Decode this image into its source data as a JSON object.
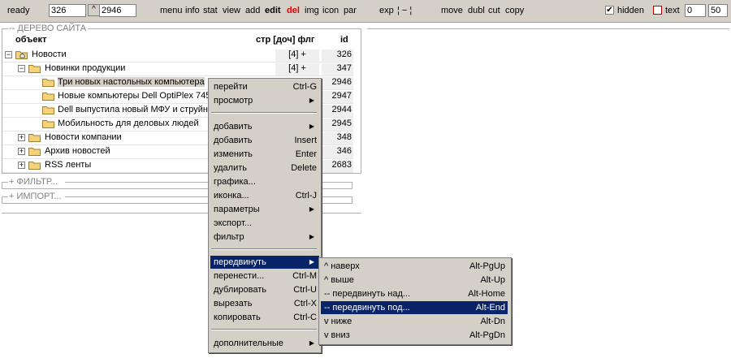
{
  "toolbar": {
    "status": "ready",
    "id_value": "326",
    "up_glyph": "^",
    "target_value": "2946",
    "menu_items": [
      "menu",
      "info",
      "stat",
      "view",
      "add"
    ],
    "edit": "edit",
    "del": "del",
    "menu_items2": [
      "img",
      "icon",
      "par"
    ],
    "exp": "exp",
    "exp_sep": "¦ − ¦",
    "actions": [
      "move",
      "dubl",
      "cut",
      "copy"
    ],
    "hidden_label": "hidden",
    "hidden_checked": true,
    "text_label": "text",
    "text_checked": false,
    "from_value": "0",
    "count_value": "50"
  },
  "tree_panel": {
    "title": "-- ДЕРЕВО САЙТА",
    "col_object": "объект",
    "col_meta": "стр [доч] флг",
    "col_id": "id"
  },
  "tree_rows": [
    {
      "expander": "−",
      "title": "Новости",
      "count": "[4] +",
      "id": "326",
      "icon": "folder-home-icon"
    },
    {
      "expander": "−",
      "title": "Новинки продукции",
      "count": "[4] +",
      "id": "347",
      "icon": "folder-icon"
    },
    {
      "expander": "",
      "title": "Три новых настольных компьютера",
      "count": "",
      "id": "2946",
      "icon": "folder-icon"
    },
    {
      "expander": "",
      "title": "Новые компьютеры Dell OptiPlex 745",
      "count": "",
      "id": "2947",
      "icon": "folder-icon"
    },
    {
      "expander": "",
      "title": "Dell выпустила новый МФУ и струйн",
      "count": "",
      "id": "2944",
      "icon": "folder-icon"
    },
    {
      "expander": "",
      "title": "Мобильность для деловых людей",
      "count": "",
      "id": "2945",
      "icon": "folder-icon"
    },
    {
      "expander": "+",
      "title": "Новости компании",
      "count": "",
      "id": "348",
      "icon": "folder-icon"
    },
    {
      "expander": "+",
      "title": "Архив новостей",
      "count": "",
      "id": "346",
      "icon": "folder-icon"
    },
    {
      "expander": "+",
      "title": "RSS ленты",
      "count": "",
      "id": "2683",
      "icon": "folder-icon"
    }
  ],
  "filter_panel": {
    "title": "+ ФИЛЬТР..."
  },
  "import_panel": {
    "title": "+ ИМПОРТ..."
  },
  "context_menu": {
    "items": [
      {
        "label": "перейти",
        "shortcut": "Ctrl-G"
      },
      {
        "label": "просмотр",
        "arrow": "▶"
      },
      {
        "label": "добавить",
        "arrow": "▶"
      },
      {
        "label": "добавить",
        "shortcut": "Insert"
      },
      {
        "label": "изменить",
        "shortcut": "Enter"
      },
      {
        "label": "удалить",
        "shortcut": "Delete"
      },
      {
        "label": "графика..."
      },
      {
        "label": "иконка...",
        "shortcut": "Ctrl-J"
      },
      {
        "label": "параметры",
        "arrow": "▶"
      },
      {
        "label": "экспорт..."
      },
      {
        "label": "фильтр",
        "arrow": "▶"
      },
      {
        "label": "передвинуть",
        "arrow": "▶"
      },
      {
        "label": "перенести...",
        "shortcut": "Ctrl-M"
      },
      {
        "label": "дублировать",
        "shortcut": "Ctrl-U"
      },
      {
        "label": "вырезать",
        "shortcut": "Ctrl-X"
      },
      {
        "label": "копировать",
        "shortcut": "Ctrl-C"
      },
      {
        "label": "дополнительные",
        "arrow": "▶"
      }
    ]
  },
  "submenu": {
    "items": [
      {
        "label": "^ наверх",
        "shortcut": "Alt-PgUp"
      },
      {
        "label": "^ выше",
        "shortcut": "Alt-Up"
      },
      {
        "label": "-- передвинуть над...",
        "shortcut": "Alt-Home"
      },
      {
        "label": "-- передвинуть под...",
        "shortcut": "Alt-End"
      },
      {
        "label": "v ниже",
        "shortcut": "Alt-Dn"
      },
      {
        "label": "v вниз",
        "shortcut": "Alt-PgDn"
      }
    ]
  }
}
